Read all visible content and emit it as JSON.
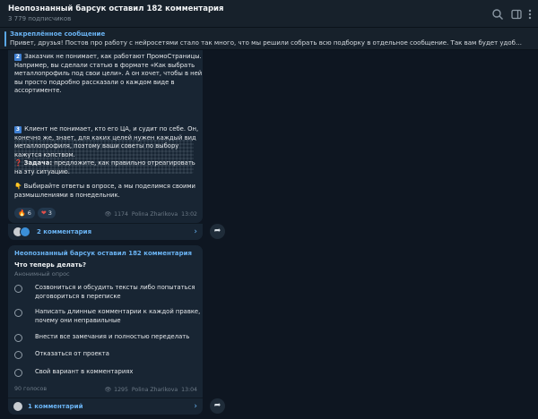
{
  "header": {
    "title": "Неопознанный барсук оставил 182 комментария",
    "subtitle": "3 779 подписчиков",
    "icons": [
      "search-icon",
      "sidebar-icon",
      "more-icon"
    ]
  },
  "pinned": {
    "title": "Закреплённое сообщение",
    "text": "Привет, друзья! Постов про работу с нейросетями стало так много, что мы решили собрать всю подборку в отдельное сообщение. Так вам будет удобно найти то, что ..."
  },
  "post1": {
    "p2": "Заказчик не понимает, как работают ПромоСтраницы. Например, вы сделали статью в формате «Как выбрать металлопрофиль под свои цели». А он хочет, чтобы в ней вы просто подробно рассказали о каждом виде в ассортименте.",
    "p3": "Клиент не понимает, кто его ЦА, и судит по себе. Он, конечно же, знает, для каких целей нужен каждый вид металлопрофиля, поэтому ваши советы по выбору кажутся кэпством.",
    "task_label": "Задача:",
    "task_text": "предложите, как правильно отреагировать на эту ситуацию.",
    "poll_call": "Выбирайте ответы в опросе, а мы поделимся своими размышлениями в понедельник.",
    "num2": "2",
    "num3": "3",
    "reactions": [
      {
        "emoji": "🔥",
        "count": "6"
      },
      {
        "emoji": "❤",
        "count": "3"
      }
    ],
    "views": "1174",
    "author": "Polina Zharikova",
    "time": "13:02",
    "comments_label": "2 комментария"
  },
  "post2": {
    "author": "Неопознанный барсук оставил 182 комментария",
    "question": "Что теперь делать?",
    "kind": "Анонимный опрос",
    "options": [
      "Созвониться и обсудить тексты либо попытаться договориться в переписке",
      "Написать длинные комментарии к каждой правке, почему они неправильные",
      "Внести все замечания и полностью переделать",
      "Отказаться от проекта",
      "Свой вариант в комментариях"
    ],
    "votes": "90 голосов",
    "views": "1295",
    "signature": "Polina Zharikova",
    "time": "13:04",
    "comments_label": "1 комментарий"
  },
  "colors": {
    "background": "#0e1621",
    "bubble": "#182533",
    "accent": "#6ab3f3"
  }
}
